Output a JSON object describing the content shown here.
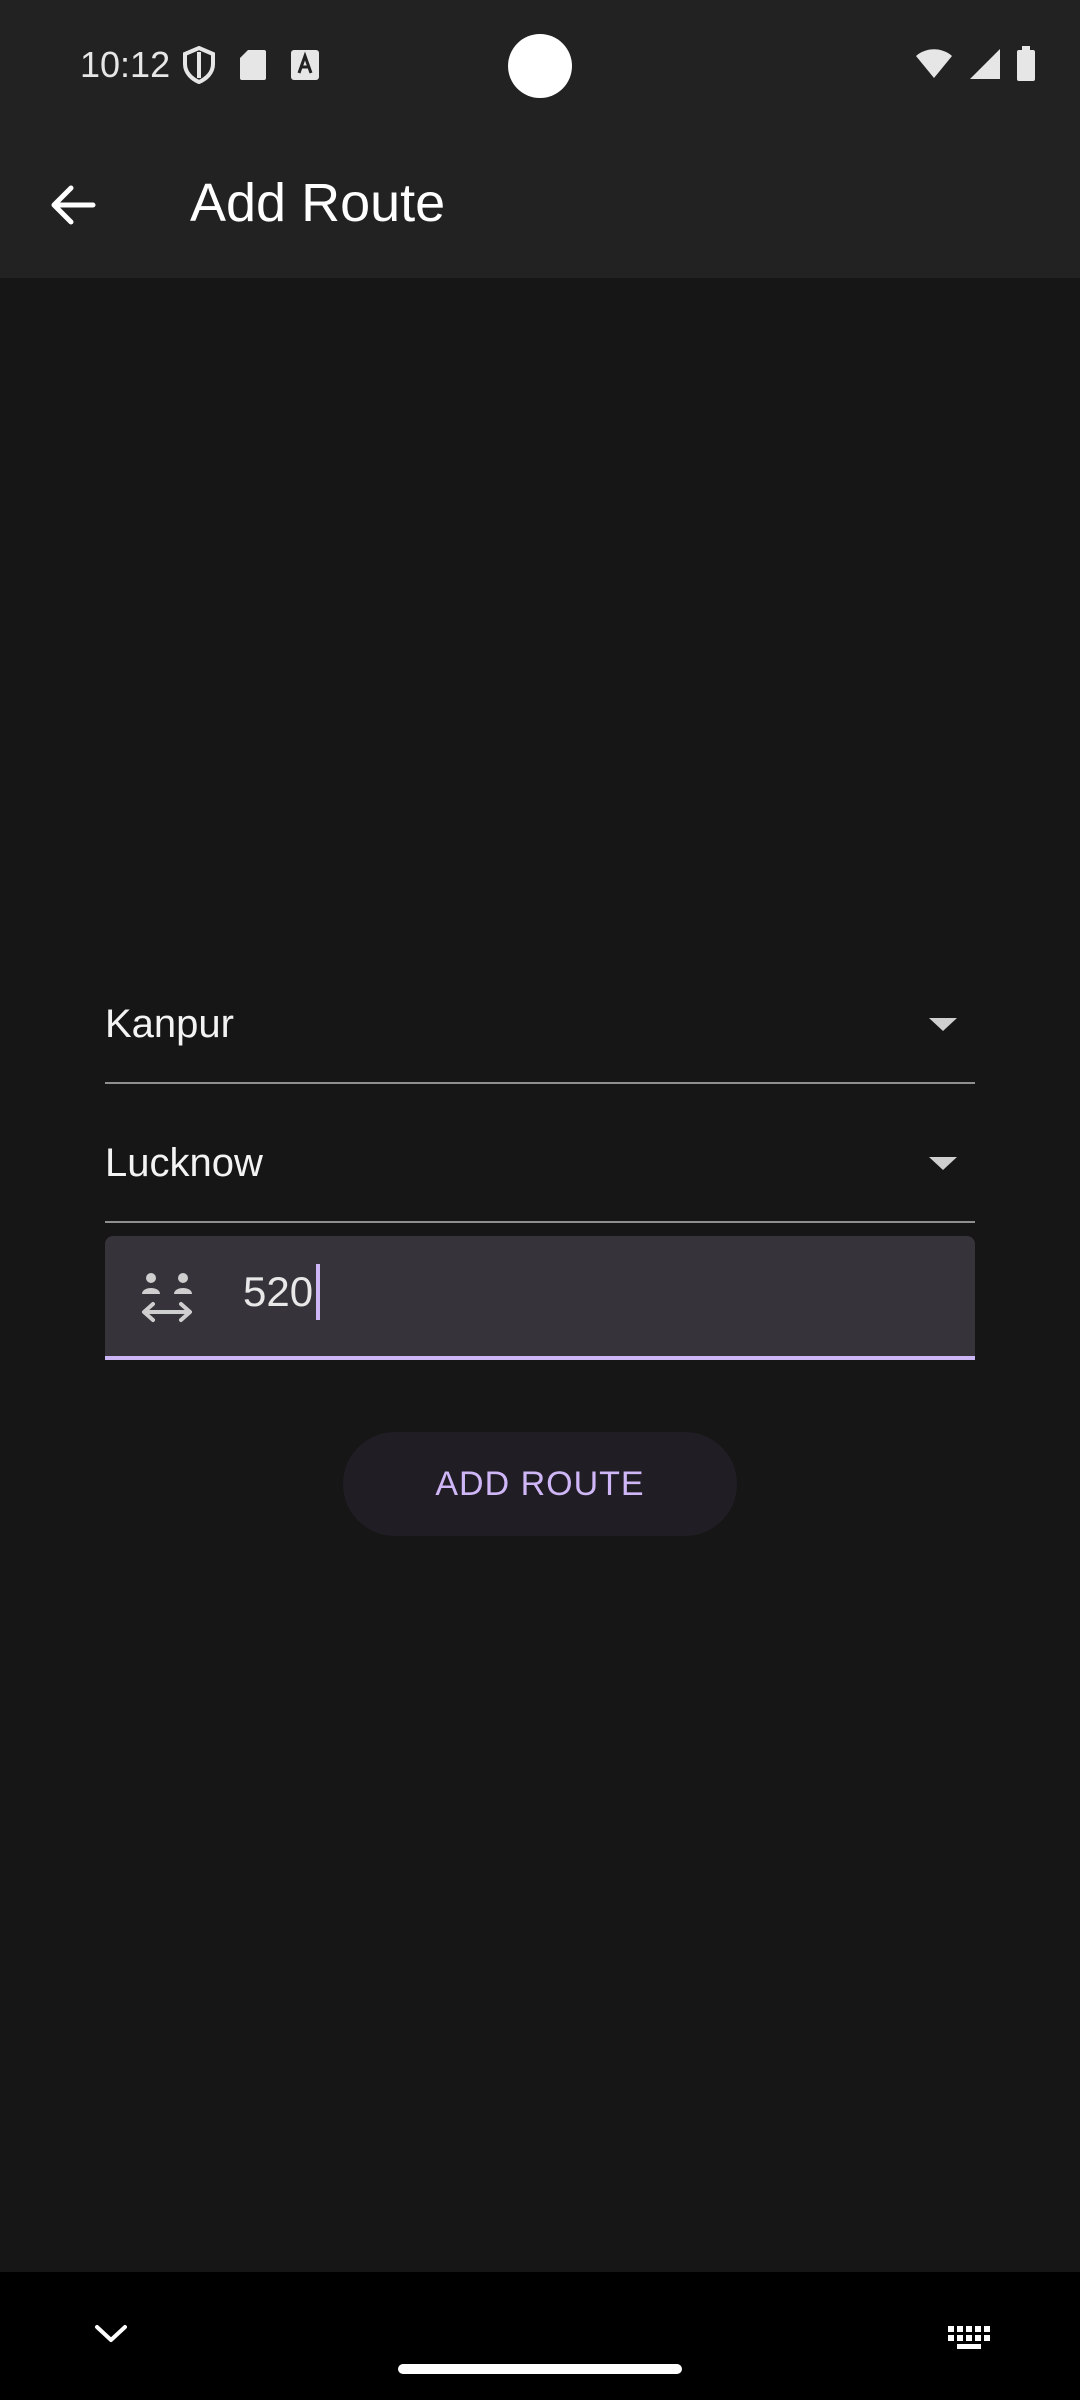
{
  "status_bar": {
    "time": "10:12",
    "icons_left": [
      "shield-icon",
      "sd-card-icon",
      "text-a-icon"
    ],
    "icons_right": [
      "wifi-icon",
      "signal-icon",
      "battery-icon"
    ]
  },
  "app_bar": {
    "title": "Add Route",
    "back_icon": "arrow-back-icon"
  },
  "form": {
    "source": {
      "value": "Kanpur"
    },
    "destination": {
      "value": "Lucknow"
    },
    "distance": {
      "value": "520",
      "icon": "distance-people-icon"
    },
    "submit_label": "ADD ROUTE"
  },
  "colors": {
    "background": "#161616",
    "app_bar": "#222222",
    "accent": "#cdb6f5",
    "field_fill": "#36333b"
  },
  "nav_bar": {
    "icons": [
      "chevron-down-icon",
      "keyboard-icon"
    ]
  }
}
